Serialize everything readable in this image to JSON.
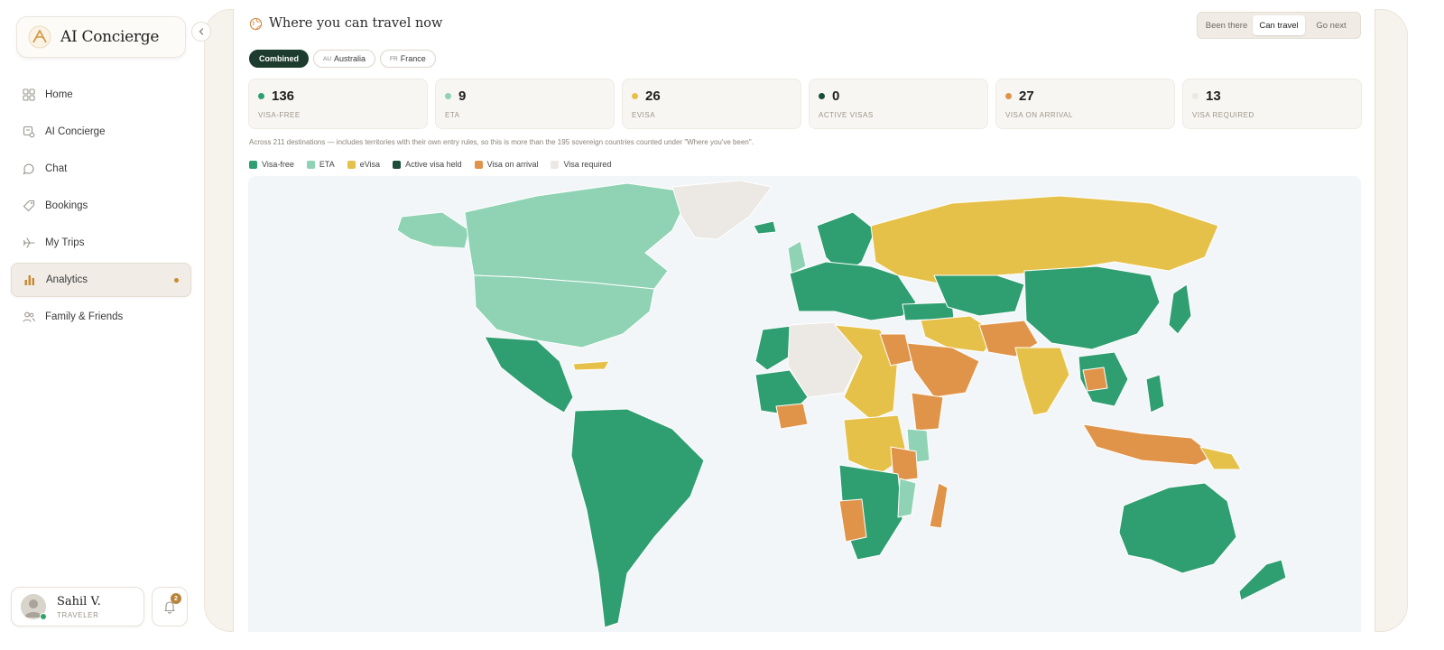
{
  "app": {
    "name": "AI Concierge"
  },
  "colors": {
    "visa_free": "#2f9e70",
    "eta": "#8fd3b4",
    "evisa": "#e6c14a",
    "active_visa": "#1b4d3a",
    "visa_on_arrival": "#e09449",
    "visa_required": "#ece8e3",
    "accent": "#c98a38"
  },
  "sidebar": {
    "items": [
      {
        "label": "Home",
        "icon": "grid-icon"
      },
      {
        "label": "AI Concierge",
        "icon": "concierge-icon"
      },
      {
        "label": "Chat",
        "icon": "chat-icon"
      },
      {
        "label": "Bookings",
        "icon": "tag-icon"
      },
      {
        "label": "My Trips",
        "icon": "plane-icon"
      },
      {
        "label": "Analytics",
        "icon": "bar-chart-icon",
        "active": true
      },
      {
        "label": "Family & Friends",
        "icon": "people-icon"
      }
    ],
    "user": {
      "name": "Sahil V.",
      "role": "TRAVELER"
    },
    "notifications": {
      "count": "2"
    }
  },
  "main": {
    "title": "Where you can travel now",
    "view_tabs": [
      "Been there",
      "Can travel",
      "Go next"
    ],
    "active_view": "Can travel",
    "chips": [
      {
        "code": "",
        "label": "Combined",
        "active": true
      },
      {
        "code": "AU",
        "label": "Australia"
      },
      {
        "code": "FR",
        "label": "France"
      }
    ],
    "stats": [
      {
        "value": "136",
        "label": "VISA-FREE",
        "color": "#2f9e70"
      },
      {
        "value": "9",
        "label": "ETA",
        "color": "#8fd3b4"
      },
      {
        "value": "26",
        "label": "EVISA",
        "color": "#e6c14a"
      },
      {
        "value": "0",
        "label": "ACTIVE VISAS",
        "color": "#1b4d3a"
      },
      {
        "value": "27",
        "label": "VISA ON ARRIVAL",
        "color": "#e09449"
      },
      {
        "value": "13",
        "label": "VISA REQUIRED",
        "color": "#ece8e3"
      }
    ],
    "note": "Across 211 destinations — includes territories with their own entry rules, so this is more than the 195 sovereign countries counted under \"Where you've been\".",
    "legend": [
      {
        "label": "Visa-free",
        "color": "#2f9e70"
      },
      {
        "label": "ETA",
        "color": "#8fd3b4"
      },
      {
        "label": "eVisa",
        "color": "#e6c14a"
      },
      {
        "label": "Active visa held",
        "color": "#1b4d3a"
      },
      {
        "label": "Visa on arrival",
        "color": "#e09449"
      },
      {
        "label": "Visa required",
        "color": "#ece8e3"
      }
    ]
  }
}
